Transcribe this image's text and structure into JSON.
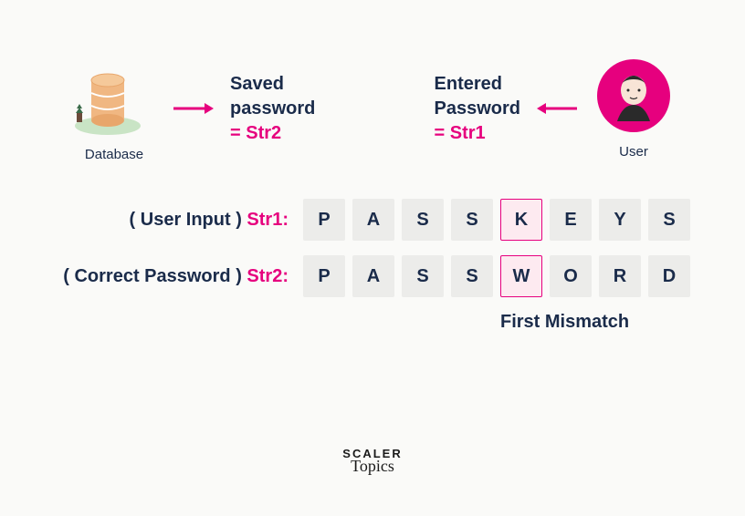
{
  "top": {
    "database_label": "Database",
    "saved_line1": "Saved",
    "saved_line2": "password",
    "saved_eq": "= Str2",
    "entered_line1": "Entered",
    "entered_line2": "Password",
    "entered_eq": "= Str1",
    "user_label": "User"
  },
  "rows": {
    "user_input_prefix": "( User Input ) ",
    "user_input_var": "Str1:",
    "correct_prefix": "( Correct Password ) ",
    "correct_var": "Str2:",
    "str1": [
      "P",
      "A",
      "S",
      "S",
      "K",
      "E",
      "Y",
      "S"
    ],
    "str2": [
      "P",
      "A",
      "S",
      "S",
      "W",
      "O",
      "R",
      "D"
    ],
    "mismatch_index": 4,
    "mismatch_label": "First Mismatch"
  },
  "logo": {
    "line1": "SCALER",
    "line2": "Topics"
  },
  "colors": {
    "accent": "#e6007e",
    "text": "#1a2b4a",
    "cell_bg": "#ececea",
    "mismatch_bg": "#fdeaf0"
  }
}
